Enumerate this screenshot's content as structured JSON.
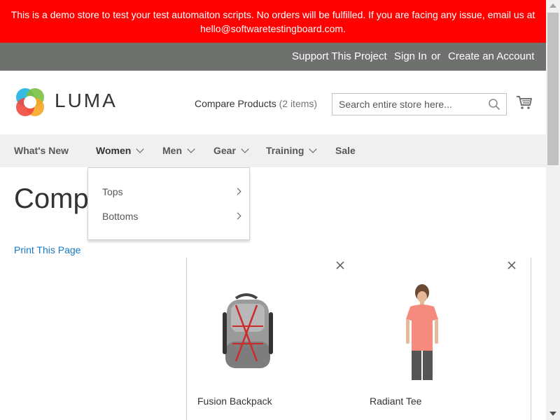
{
  "banner": {
    "line1": "This is a demo store to test your test automaiton scripts. No orders will be fulfilled. If you are facing any issue, email us at",
    "line2": "hello@softwaretestingboard.com."
  },
  "top_links": {
    "support": "Support This Project",
    "sign_in": "Sign In",
    "or": "or",
    "create_account": "Create an Account"
  },
  "header": {
    "logo_text": "LUMA",
    "compare_label": "Compare Products",
    "compare_count": "(2 items)",
    "search_placeholder": "Search entire store here..."
  },
  "nav": {
    "items": [
      "What's New",
      "Women",
      "Men",
      "Gear",
      "Training",
      "Sale"
    ]
  },
  "dropdown": {
    "items": [
      "Tops",
      "Bottoms"
    ]
  },
  "page": {
    "title": "Comp",
    "print_link": "Print This Page"
  },
  "products": [
    {
      "name": "Fusion Backpack"
    },
    {
      "name": "Radiant Tee"
    }
  ],
  "colors": {
    "banner_bg": "#ff0101",
    "top_bar_bg": "#6e716e",
    "nav_bg": "#f0f0f0",
    "link": "#1979c3"
  }
}
